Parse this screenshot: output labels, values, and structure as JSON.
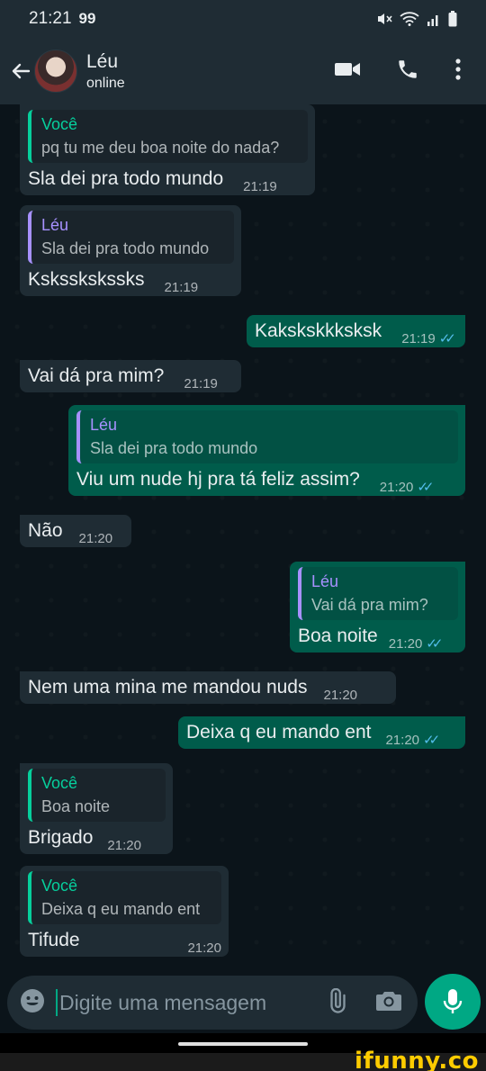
{
  "status_bar": {
    "time": "21:21",
    "carrier_badge": "99"
  },
  "header": {
    "contact_name": "Léu",
    "contact_status": "online"
  },
  "messages": [
    {
      "dir": "in",
      "quote": {
        "author": "Você",
        "text": "pq tu me deu boa noite do nada?"
      },
      "text": "Sla dei pra todo mundo",
      "time": "21:19"
    },
    {
      "dir": "in",
      "quote": {
        "author": "Léu",
        "text": "Sla dei pra todo mundo"
      },
      "text": "Ksksskskssks",
      "time": "21:19"
    },
    {
      "dir": "out",
      "text": "Kakskskkksksk",
      "time": "21:19",
      "read": true
    },
    {
      "dir": "in",
      "text": "Vai dá pra mim?",
      "time": "21:19"
    },
    {
      "dir": "out",
      "quote": {
        "author": "Léu",
        "text": "Sla dei pra todo mundo"
      },
      "text": "Viu um nude hj pra tá feliz assim?",
      "time": "21:20",
      "read": true
    },
    {
      "dir": "in",
      "text": "Não",
      "time": "21:20"
    },
    {
      "dir": "out",
      "quote": {
        "author": "Léu",
        "text": "Vai dá pra mim?"
      },
      "text": "Boa noite",
      "time": "21:20",
      "read": true
    },
    {
      "dir": "in",
      "text": "Nem uma mina me mandou nuds",
      "time": "21:20"
    },
    {
      "dir": "out",
      "text": "Deixa q eu mando ent",
      "time": "21:20",
      "read": true
    },
    {
      "dir": "in",
      "quote": {
        "author": "Você",
        "text": "Boa noite"
      },
      "text": "Brigado",
      "time": "21:20"
    },
    {
      "dir": "in",
      "quote": {
        "author": "Você",
        "text": "Deixa q eu mando ent"
      },
      "text": "Tifude",
      "time": "21:20"
    }
  ],
  "composer": {
    "placeholder": "Digite uma mensagem"
  },
  "watermark": "ifunny.co",
  "colors": {
    "background": "#0b141a",
    "bar": "#1f2c34",
    "incoming": "#1f2c34",
    "outgoing": "#005c4b",
    "accent": "#00a884",
    "quote_you": "#06cf9c",
    "quote_leu": "#a791ff",
    "read_ticks": "#53bdeb"
  },
  "icons": [
    "back-arrow-icon",
    "video-call-icon",
    "phone-icon",
    "menu-dots-icon",
    "emoji-icon",
    "attach-icon",
    "camera-icon",
    "mic-icon"
  ]
}
